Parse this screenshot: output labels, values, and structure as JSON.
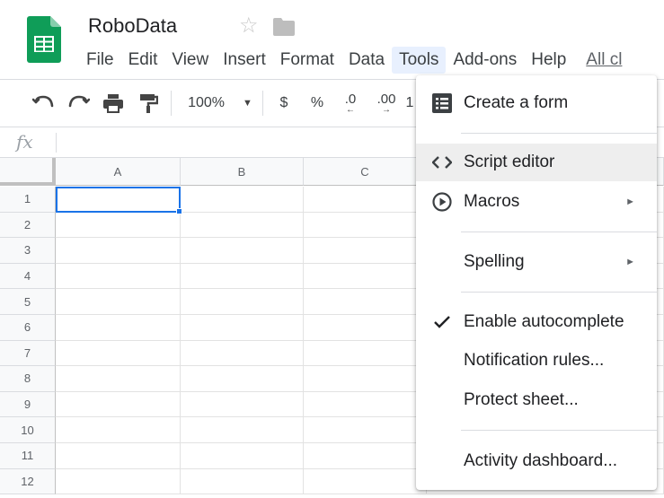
{
  "document": {
    "title": "RoboData"
  },
  "menubar": {
    "items": [
      {
        "label": "File"
      },
      {
        "label": "Edit"
      },
      {
        "label": "View"
      },
      {
        "label": "Insert"
      },
      {
        "label": "Format"
      },
      {
        "label": "Data"
      },
      {
        "label": "Tools"
      },
      {
        "label": "Add-ons"
      },
      {
        "label": "Help"
      },
      {
        "label": "All cl"
      }
    ]
  },
  "toolbar": {
    "zoom": "100%",
    "currency": "$",
    "percent": "%",
    "decrease_decimal": ".0",
    "increase_decimal": ".00",
    "more_formats": "1"
  },
  "formula_bar": {
    "fx_label": "fx"
  },
  "grid": {
    "columns": [
      "A",
      "B",
      "C"
    ],
    "rows": [
      "1",
      "2",
      "3",
      "4",
      "5",
      "6",
      "7",
      "8",
      "9",
      "10",
      "11",
      "12"
    ],
    "selected_cell": "A1"
  },
  "tools_menu": {
    "items": [
      {
        "label": "Create a form",
        "icon": "form-icon"
      },
      {
        "label": "Script editor",
        "icon": "code-icon"
      },
      {
        "label": "Macros",
        "icon": "play-circle-icon",
        "submenu": "►"
      },
      {
        "label": "Spelling",
        "submenu": "►"
      },
      {
        "label": "Enable autocomplete",
        "icon": "check-icon"
      },
      {
        "label": "Notification rules..."
      },
      {
        "label": "Protect sheet..."
      },
      {
        "label": "Activity dashboard..."
      }
    ]
  },
  "colors": {
    "accent": "#1a73e8",
    "logo_green": "#0f9d58",
    "menu_active_bg": "#e8f0fe"
  }
}
